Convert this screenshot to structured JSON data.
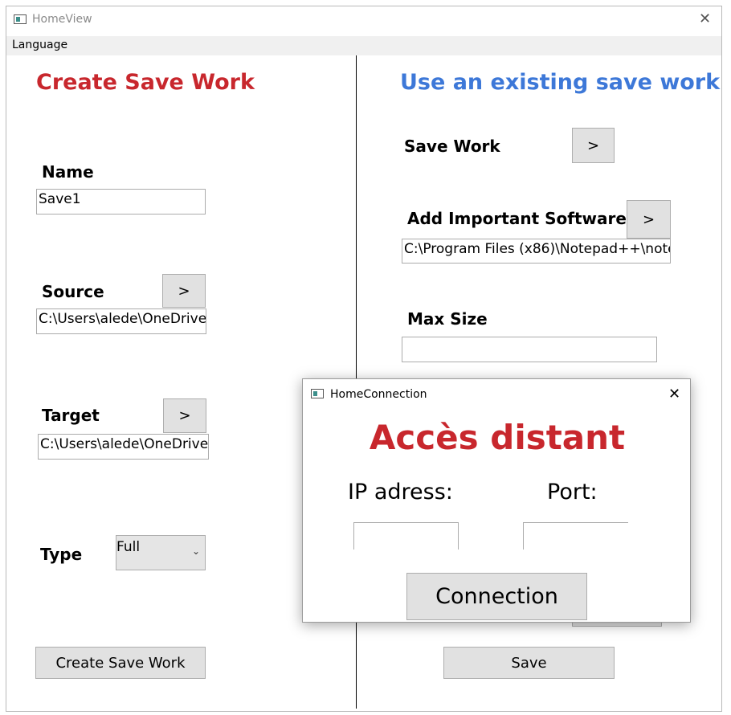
{
  "window": {
    "title": "HomeView"
  },
  "menu": {
    "language": "Language"
  },
  "left": {
    "heading": "Create Save Work",
    "name_label": "Name",
    "name_value": "Save1",
    "source_label": "Source",
    "source_value": "C:\\Users\\alede\\OneDrive",
    "target_label": "Target",
    "target_value": "C:\\Users\\alede\\OneDrive",
    "type_label": "Type",
    "type_value": "Full",
    "browse_label": ">",
    "create_button": "Create Save Work"
  },
  "right": {
    "heading": "Use an existing save work",
    "save_work_label": "Save Work",
    "add_software_label": "Add Important Software",
    "software_value": "C:\\Program Files (x86)\\Notepad++\\note",
    "max_size_label": "Max Size",
    "max_size_value": "",
    "browse_label": ">",
    "save_button": "Save"
  },
  "dialog": {
    "title": "HomeConnection",
    "heading": "Accès distant",
    "ip_label": "IP adress:",
    "port_label": "Port:",
    "ip_value": "",
    "port_value": "",
    "connect_button": "Connection"
  },
  "colors": {
    "red_heading": "#c8272d",
    "blue_heading": "#3d78d8"
  }
}
